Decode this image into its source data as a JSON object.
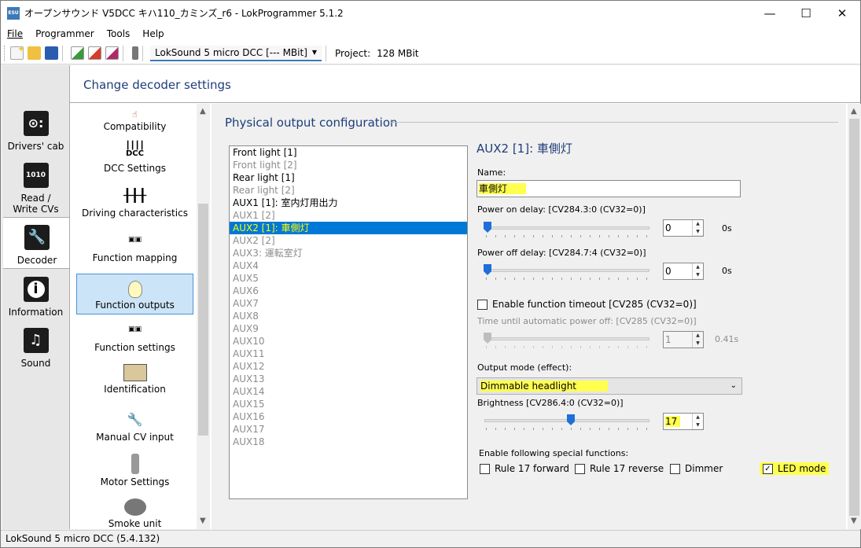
{
  "window": {
    "title": "オープンサウンド V5DCC キハ110_カミンズ_r6 - LokProgrammer 5.1.2",
    "app_icon_text": "ESU",
    "minimize": "—",
    "maximize": "☐",
    "close": "✕"
  },
  "menu": {
    "file": "File",
    "programmer": "Programmer",
    "tools": "Tools",
    "help": "Help"
  },
  "toolbar": {
    "decoder": "LokSound 5 micro DCC [--- MBit]",
    "project_label": "Project:",
    "project_value": "128 MBit"
  },
  "sidebar": {
    "items": [
      {
        "label": "Drivers' cab",
        "icon": "drivers-cab-icon"
      },
      {
        "label": "Read / Write CVs",
        "icon": "read-write-icon"
      },
      {
        "label": "Decoder",
        "icon": "decoder-wrench-icon"
      },
      {
        "label": "Information",
        "icon": "information-icon"
      },
      {
        "label": "Sound",
        "icon": "sound-icon"
      }
    ]
  },
  "header": {
    "title": "Change decoder settings"
  },
  "categories": [
    {
      "label": "Compatibility",
      "icon": "hand-icon"
    },
    {
      "label": "DCC Settings",
      "icon": "dcc-icon"
    },
    {
      "label": "Driving characteristics",
      "icon": "sliders-icon"
    },
    {
      "label": "Function mapping",
      "icon": "function-mapping-icon"
    },
    {
      "label": "Function outputs",
      "icon": "lightbulb-icon"
    },
    {
      "label": "Function settings",
      "icon": "function-settings-icon"
    },
    {
      "label": "Identification",
      "icon": "id-card-icon"
    },
    {
      "label": "Manual CV input",
      "icon": "wrench-icon"
    },
    {
      "label": "Motor Settings",
      "icon": "motor-icon"
    },
    {
      "label": "Smoke unit",
      "icon": "smoke-icon"
    }
  ],
  "physical": {
    "title": "Physical output configuration",
    "outputs": [
      {
        "label": "Front light [1]",
        "state": "enabled"
      },
      {
        "label": "Front light [2]",
        "state": "disabled"
      },
      {
        "label": "Rear light [1]",
        "state": "enabled"
      },
      {
        "label": "Rear light [2]",
        "state": "disabled"
      },
      {
        "label": "AUX1 [1]: 室内灯用出力",
        "state": "enabled"
      },
      {
        "label": "AUX1 [2]",
        "state": "disabled"
      },
      {
        "label": "AUX2 [1]: 車側灯",
        "state": "selected"
      },
      {
        "label": "AUX2 [2]",
        "state": "disabled"
      },
      {
        "label": "AUX3: 運転室灯",
        "state": "disabled"
      },
      {
        "label": "AUX4",
        "state": "disabled"
      },
      {
        "label": "AUX5",
        "state": "disabled"
      },
      {
        "label": "AUX6",
        "state": "disabled"
      },
      {
        "label": "AUX7",
        "state": "disabled"
      },
      {
        "label": "AUX8",
        "state": "disabled"
      },
      {
        "label": "AUX9",
        "state": "disabled"
      },
      {
        "label": "AUX10",
        "state": "disabled"
      },
      {
        "label": "AUX11",
        "state": "disabled"
      },
      {
        "label": "AUX12",
        "state": "disabled"
      },
      {
        "label": "AUX13",
        "state": "disabled"
      },
      {
        "label": "AUX14",
        "state": "disabled"
      },
      {
        "label": "AUX15",
        "state": "disabled"
      },
      {
        "label": "AUX16",
        "state": "disabled"
      },
      {
        "label": "AUX17",
        "state": "disabled"
      },
      {
        "label": "AUX18",
        "state": "disabled"
      }
    ]
  },
  "detail": {
    "title": "AUX2 [1]: 車側灯",
    "name_label": "Name:",
    "name_value": "車側灯",
    "power_on_label": "Power on delay: [CV284.3:0 (CV32=0)]",
    "power_on_value": "0",
    "power_on_unit": "0s",
    "power_off_label": "Power off delay: [CV284.7:4 (CV32=0)]",
    "power_off_value": "0",
    "power_off_unit": "0s",
    "timeout_label": "Enable function timeout [CV285 (CV32=0)]",
    "auto_off_label": "Time until automatic power off: [CV285 (CV32=0)]",
    "auto_off_value": "1",
    "auto_off_unit": "0.41s",
    "mode_label": "Output mode (effect):",
    "mode_value": "Dimmable headlight",
    "brightness_label": "Brightness [CV286.4:0 (CV32=0)]",
    "brightness_value": "17",
    "brightness_fraction": 0.55,
    "special_label": "Enable following special functions:",
    "rule17f": "Rule 17 forward",
    "rule17r": "Rule 17 reverse",
    "dimmer": "Dimmer",
    "led_mode": "LED mode",
    "checked_mark": "✓"
  },
  "status": {
    "text": "LokSound 5 micro DCC (5.4.132)"
  },
  "colors": {
    "accent": "#0078d7",
    "highlight": "#ffff4f",
    "heading": "#1e3d7a"
  }
}
